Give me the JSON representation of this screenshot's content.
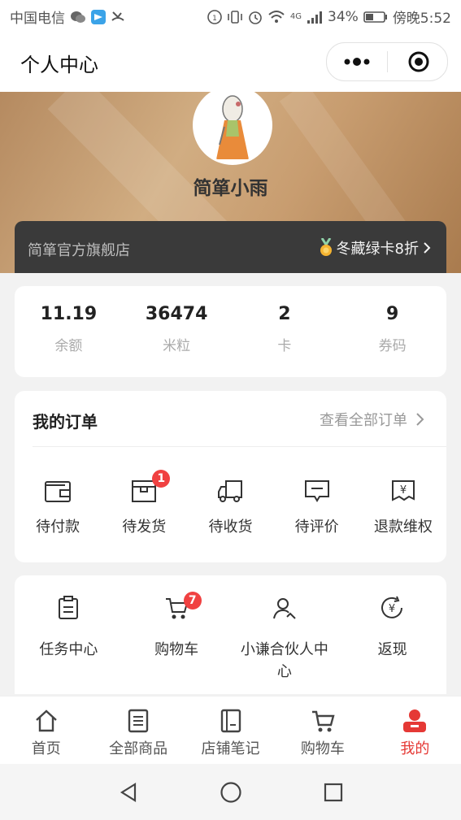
{
  "status_bar": {
    "carrier": "中国电信",
    "network": "4G",
    "battery": "34%",
    "time": "傍晚5:52"
  },
  "navbar": {
    "title": "个人中心"
  },
  "profile": {
    "name": "简箪小雨",
    "shop_name": "简箪官方旗舰店",
    "membership_card": "冬藏绿卡8折"
  },
  "stats": [
    {
      "value": "11.19",
      "label": "余额"
    },
    {
      "value": "36474",
      "label": "米粒"
    },
    {
      "value": "2",
      "label": "卡"
    },
    {
      "value": "9",
      "label": "券码"
    }
  ],
  "orders": {
    "title": "我的订单",
    "view_all": "查看全部订单",
    "items": [
      {
        "label": "待付款",
        "icon": "wallet-icon"
      },
      {
        "label": "待发货",
        "icon": "box-icon",
        "badge": "1"
      },
      {
        "label": "待收货",
        "icon": "truck-icon"
      },
      {
        "label": "待评价",
        "icon": "comment-icon"
      },
      {
        "label": "退款维权",
        "icon": "refund-icon"
      }
    ]
  },
  "services": [
    {
      "label": "任务中心",
      "icon": "clipboard-icon"
    },
    {
      "label": "购物车",
      "icon": "cart-icon",
      "badge": "7"
    },
    {
      "label": "小谦合伙人中心",
      "icon": "partner-icon"
    },
    {
      "label": "返现",
      "icon": "cashback-icon"
    }
  ],
  "tabbar": [
    {
      "label": "首页",
      "icon": "home-icon"
    },
    {
      "label": "全部商品",
      "icon": "list-icon"
    },
    {
      "label": "店铺笔记",
      "icon": "notebook-icon"
    },
    {
      "label": "购物车",
      "icon": "cart-icon"
    },
    {
      "label": "我的",
      "icon": "user-icon",
      "active": true
    }
  ],
  "colors": {
    "accent": "#e53935",
    "badge": "#f04141",
    "vip_bar": "#3a3a3a",
    "banner": "#c89d70"
  }
}
